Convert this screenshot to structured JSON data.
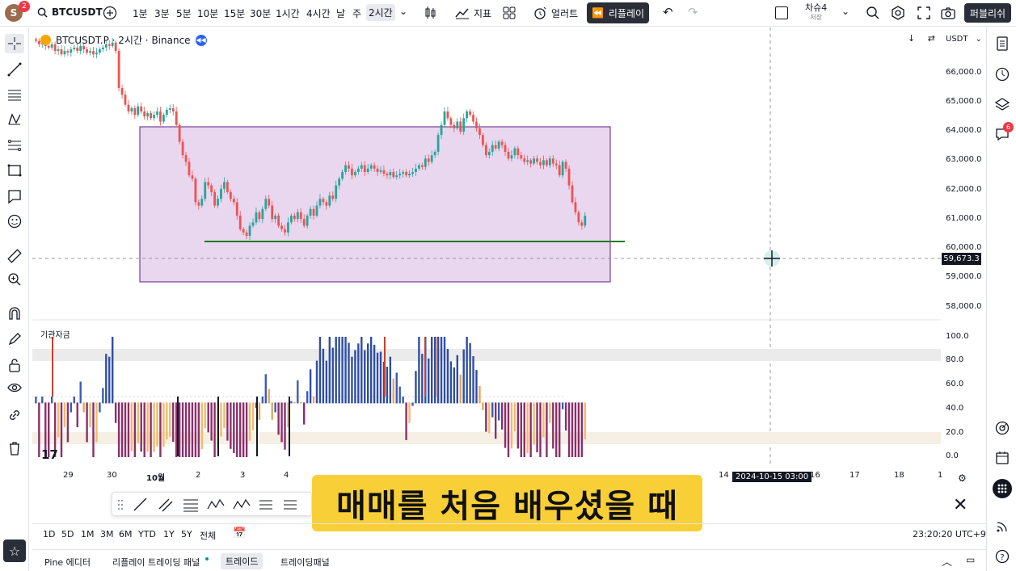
{
  "header": {
    "avatar_letter": "S",
    "notification_count": "2",
    "symbol": "BTCUSDT",
    "intervals": [
      "1분",
      "3분",
      "5분",
      "10분",
      "15분",
      "30분",
      "1시간",
      "4시간",
      "날",
      "주",
      "2시간"
    ],
    "selected_interval": "2시간",
    "indicators_label": "지표",
    "alert_label": "얼러트",
    "replay_label": "리플레이",
    "layout_name": "차슈4",
    "layout_status": "저장",
    "publish_label": "퍼블리쉬"
  },
  "legend": {
    "title": "BTCUSDT.P · 2시간 · Binance"
  },
  "price_axis": {
    "currency": "USDT",
    "labels": [
      "66,000.0",
      "65,000.0",
      "64,000.0",
      "63,000.0",
      "62,000.0",
      "61,000.0",
      "60,000.0",
      "59,000.0",
      "58,000.0"
    ],
    "cursor_price": "59,673.3"
  },
  "indicator": {
    "name": "기관자금",
    "axis_labels": [
      "100.0",
      "80.0",
      "60.0",
      "40.0",
      "20.0",
      "0.0"
    ]
  },
  "time_axis": {
    "labels": [
      "29",
      "30",
      "10월",
      "2",
      "3",
      "4",
      "14",
      "16",
      "17",
      "18",
      "1"
    ],
    "cursor_label": "2024-10-15   03:00"
  },
  "caption": "매매를 처음 배우셨을 때",
  "range_bar": {
    "ranges": [
      "1D",
      "5D",
      "1M",
      "3M",
      "6M",
      "YTD",
      "1Y",
      "5Y",
      "전체"
    ],
    "clock": "23:20:20 UTC+9"
  },
  "bottom_tabs": [
    "Pine 에디터",
    "리플레이 트레이딩 패널",
    "트레이드",
    "트레이딩패널"
  ],
  "right_badge": "6",
  "colors": {
    "up": "#26a69a",
    "down": "#ef5350",
    "box_fill": "#e9d6ef",
    "box_border": "#7b3f98",
    "support_line": "#1b7a1b",
    "accent": "#2962ff"
  },
  "chart_data": {
    "type": "candlestick",
    "ylim": [
      57700,
      66400
    ],
    "closes": [
      66000,
      65900,
      65950,
      65850,
      65800,
      65900,
      65700,
      65750,
      65600,
      65700,
      65650,
      65750,
      65800,
      65700,
      65850,
      65750,
      65650,
      65700,
      65600,
      65650,
      65750,
      65800,
      65900,
      65850,
      65950,
      65700,
      64600,
      64400,
      64100,
      63900,
      64000,
      63800,
      64050,
      63900,
      63750,
      63850,
      63700,
      63800,
      63900,
      63600,
      63800,
      63950,
      64000,
      63900,
      63500,
      63000,
      62600,
      62400,
      62000,
      61900,
      61200,
      61100,
      61300,
      61800,
      61700,
      61500,
      61100,
      61300,
      61600,
      61800,
      61500,
      61300,
      61200,
      60800,
      60400,
      60300,
      60200,
      60500,
      60600,
      60900,
      60700,
      61000,
      61300,
      61100,
      60700,
      60800,
      60500,
      60400,
      60300,
      60600,
      60800,
      60700,
      60900,
      60700,
      60500,
      60800,
      61000,
      60800,
      61100,
      61300,
      61200,
      61100,
      61400,
      61300,
      61700,
      61900,
      62100,
      62300,
      62200,
      62000,
      62100,
      62200,
      62300,
      62100,
      62200,
      62300,
      62200,
      62100,
      62150,
      62050,
      62000,
      62100,
      61950,
      62000,
      62050,
      62100,
      62000,
      62050,
      62100,
      62200,
      62300,
      62250,
      62500,
      62400,
      62600,
      62700,
      63200,
      63500,
      63900,
      63700,
      63500,
      63400,
      63600,
      63300,
      63700,
      63900,
      63800,
      63600,
      63400,
      63200,
      62900,
      62600,
      62700,
      62900,
      62800,
      63000,
      62900,
      62700,
      62500,
      62600,
      62800,
      62600,
      62500,
      62400,
      62450,
      62350,
      62500,
      62400,
      62300,
      62450,
      62300,
      62500,
      62350,
      62300,
      62000,
      62400,
      62200,
      61700,
      61200,
      60900,
      60600,
      60500,
      60800
    ]
  }
}
